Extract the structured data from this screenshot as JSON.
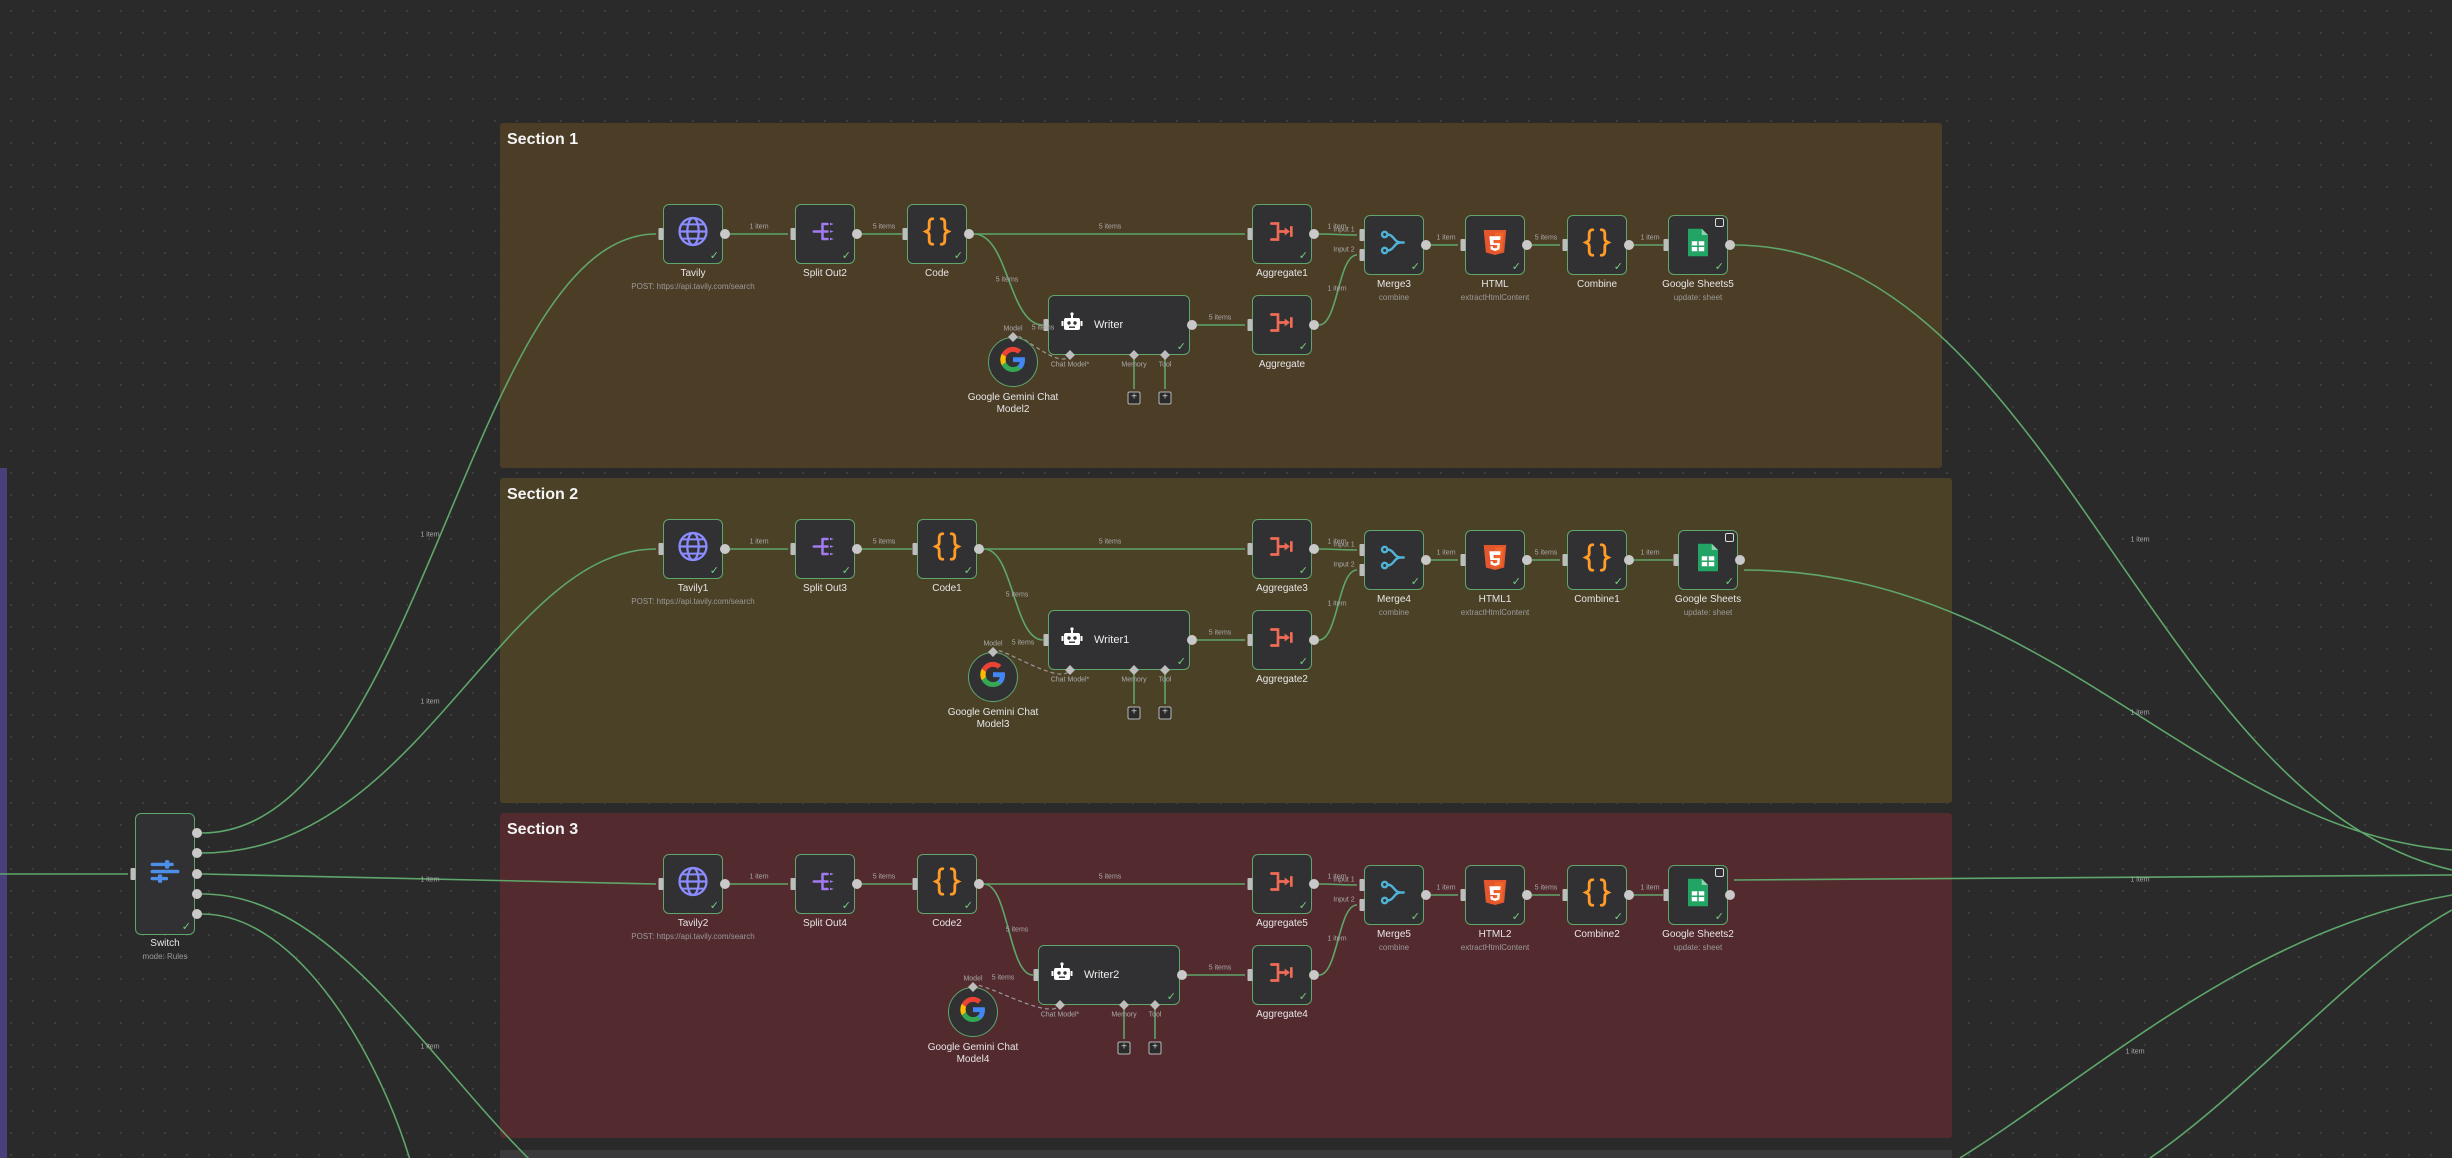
{
  "canvas": {
    "background": "#2a2a2b",
    "accent": "#5fa66a"
  },
  "sections": [
    {
      "title": "Section 1",
      "color": "#4c3d27"
    },
    {
      "title": "Section 2",
      "color": "#4b4127"
    },
    {
      "title": "Section 3",
      "color": "#532a2e"
    }
  ],
  "switch_node": {
    "label": "Switch",
    "sub": "mode: Rules"
  },
  "nodes": {
    "s1": {
      "tavily": {
        "label": "Tavily",
        "sub": "POST: https://api.tavily.com/search"
      },
      "split": {
        "label": "Split Out2"
      },
      "code": {
        "label": "Code"
      },
      "writer": {
        "label": "Writer"
      },
      "agg_top": {
        "label": "Aggregate1"
      },
      "agg_bottom": {
        "label": "Aggregate"
      },
      "merge": {
        "label": "Merge3",
        "sub": "combine"
      },
      "html": {
        "label": "HTML",
        "sub": "extractHtmlContent"
      },
      "combine": {
        "label": "Combine"
      },
      "sheets": {
        "label": "Google Sheets5",
        "sub": "update: sheet"
      },
      "gemini": {
        "label": "Google Gemini Chat Model2"
      }
    },
    "s2": {
      "tavily": {
        "label": "Tavily1",
        "sub": "POST: https://api.tavily.com/search"
      },
      "split": {
        "label": "Split Out3"
      },
      "code": {
        "label": "Code1"
      },
      "writer": {
        "label": "Writer1"
      },
      "agg_top": {
        "label": "Aggregate3"
      },
      "agg_bottom": {
        "label": "Aggregate2"
      },
      "merge": {
        "label": "Merge4",
        "sub": "combine"
      },
      "html": {
        "label": "HTML1",
        "sub": "extractHtmlContent"
      },
      "combine": {
        "label": "Combine1"
      },
      "sheets": {
        "label": "Google Sheets",
        "sub": "update: sheet"
      },
      "gemini": {
        "label": "Google Gemini Chat Model3"
      }
    },
    "s3": {
      "tavily": {
        "label": "Tavily2",
        "sub": "POST: https://api.tavily.com/search"
      },
      "split": {
        "label": "Split Out4"
      },
      "code": {
        "label": "Code2"
      },
      "writer": {
        "label": "Writer2"
      },
      "agg_top": {
        "label": "Aggregate5"
      },
      "agg_bottom": {
        "label": "Aggregate4"
      },
      "merge": {
        "label": "Merge5",
        "sub": "combine"
      },
      "html": {
        "label": "HTML2",
        "sub": "extractHtmlContent"
      },
      "combine": {
        "label": "Combine2"
      },
      "sheets": {
        "label": "Google Sheets2",
        "sub": "update: sheet"
      },
      "gemini": {
        "label": "Google Gemini Chat Model4"
      }
    }
  },
  "connection_labels": {
    "one_item": "1 item",
    "five_items": "5 items",
    "input1": "Input 1",
    "input2": "Input 2",
    "chat_model": "Chat Model*",
    "memory": "Memory",
    "tool": "Tool",
    "model": "Model"
  },
  "icons": {
    "tavily": "globe-icon",
    "split": "split-out-icon",
    "code": "code-braces-icon",
    "writer": "robot-icon",
    "aggregate": "aggregate-icon",
    "merge": "merge-icon",
    "html": "html5-icon",
    "combine": "code-braces-icon",
    "sheets": "google-sheets-icon",
    "gemini": "google-g-icon",
    "switch": "switch-icon"
  }
}
